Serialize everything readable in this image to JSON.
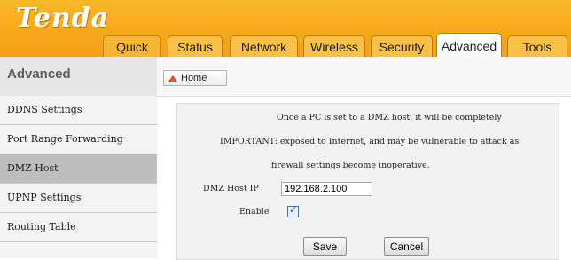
{
  "brand": {
    "logo_text": "Tenda"
  },
  "nav": {
    "tabs": [
      {
        "label": "Quick Setup"
      },
      {
        "label": "Status"
      },
      {
        "label": "Network"
      },
      {
        "label": "Wireless"
      },
      {
        "label": "Security"
      },
      {
        "label": "Advanced"
      },
      {
        "label": "Tools"
      }
    ],
    "active_tab": "Advanced"
  },
  "sidebar": {
    "title": "Advanced",
    "items": [
      {
        "label": "DDNS Settings"
      },
      {
        "label": "Port Range Forwarding"
      },
      {
        "label": "DMZ Host"
      },
      {
        "label": "UPNP Settings"
      },
      {
        "label": "Routing Table"
      }
    ],
    "active_item": "DMZ Host"
  },
  "topbar": {
    "home_label": "Home"
  },
  "dmz": {
    "line1": "Once a PC is set to a DMZ host, it will be completely",
    "line2": "IMPORTANT: exposed to Internet, and may be vulnerable to attack as",
    "line3": "firewall settings become inoperative.",
    "ip_label": "DMZ Host IP",
    "ip_value": "192.168.2.100",
    "enable_label": "Enable",
    "enable_checked": true,
    "save_label": "Save",
    "cancel_label": "Cancel"
  },
  "colors": {
    "header_orange": "#f6a819",
    "active_sidebar": "#bebebe",
    "panel_bg": "#f2f2f2"
  }
}
